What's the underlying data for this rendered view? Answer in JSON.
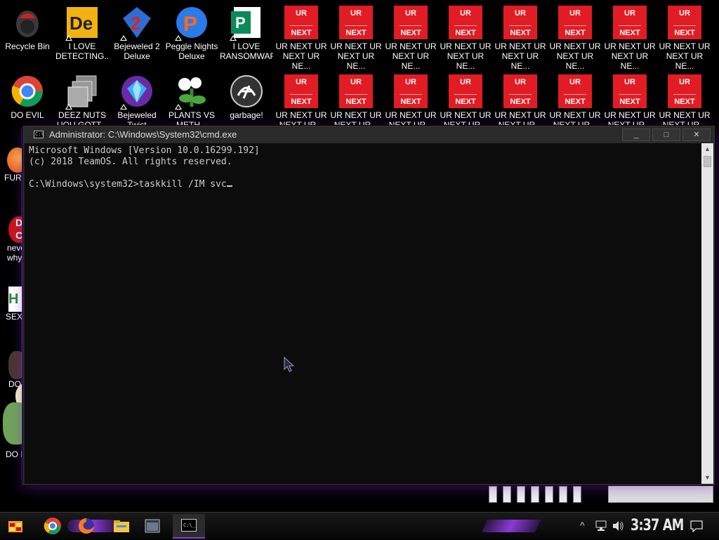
{
  "desktop": {
    "row1": [
      {
        "name": "recycle-bin",
        "label": "Recycle Bin"
      },
      {
        "name": "i-love-detecting",
        "label": "I LOVE\nDETECTING..."
      },
      {
        "name": "bejeweled-2",
        "label": "Bejeweled 2\nDeluxe"
      },
      {
        "name": "peggle-nights",
        "label": "Peggle Nights\nDeluxe"
      },
      {
        "name": "i-love-ransomware",
        "label": "I LOVE\nRANSOMWARE"
      }
    ],
    "row2": [
      {
        "name": "do-evil",
        "label": "DO EVIL"
      },
      {
        "name": "deez-nuts",
        "label": "DEEZ NUTS\nUOU GOTT..."
      },
      {
        "name": "bejeweled",
        "label": "Bejeweled\nTwist"
      },
      {
        "name": "plants-vs",
        "label": "PLANTS VS\nMETH..."
      },
      {
        "name": "garbage",
        "label": "garbage!"
      }
    ],
    "red_tile": {
      "top": "UR",
      "bottom": "NEXT",
      "label_row1": "UR NEXT UR\nNEXT UR NE...",
      "label_row2": "UR NEXT UR\nNEXT UR..."
    },
    "left_labels": [
      "FURR",
      "neve\nwhy",
      "SEX",
      "DO",
      "DO I"
    ]
  },
  "cmd": {
    "title": "Administrator: C:\\Windows\\System32\\cmd.exe",
    "icon_text": "C:\\",
    "lines": [
      "Microsoft Windows [Version 10.0.16299.192]",
      "(c) 2018 TeamOS. All rights reserved.",
      "",
      "C:\\Windows\\system32>taskkill /IM svc"
    ],
    "minimize": "_",
    "maximize": "□",
    "close": "✕"
  },
  "taskbar": {
    "clock": "3:37 AM",
    "caret": "^"
  },
  "colors": {
    "accent": "#8a3bd6",
    "tile": "#e21c24"
  }
}
